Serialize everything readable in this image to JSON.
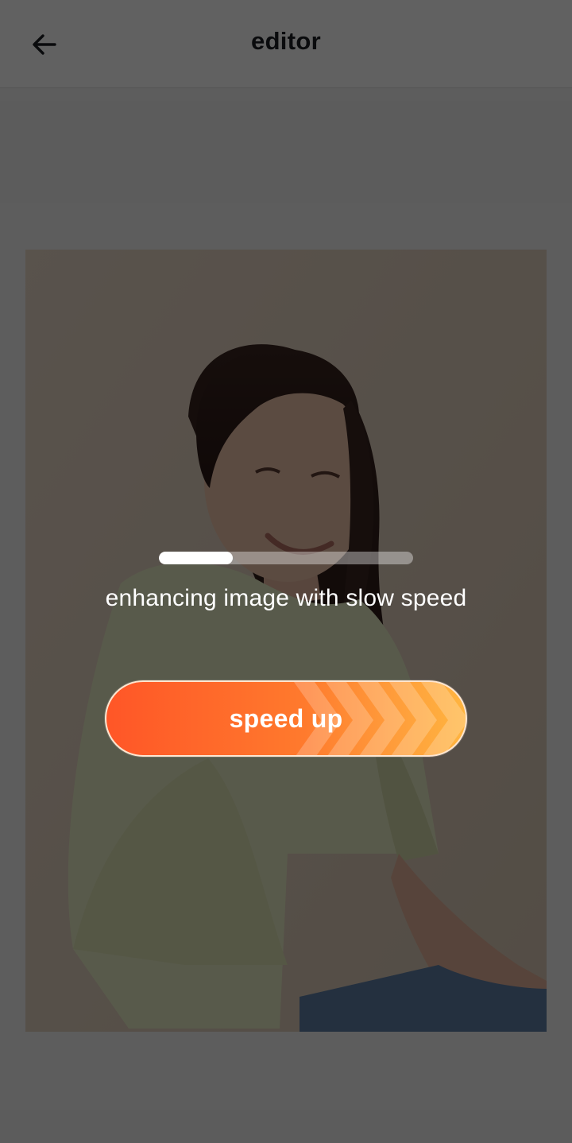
{
  "header": {
    "title": "editor",
    "back_icon": "arrow-left-icon"
  },
  "photo": {
    "subject": "woman in pale yellow blouse on beige background"
  },
  "progress": {
    "value": 0.29,
    "status_text": "enhancing image with slow speed"
  },
  "actions": {
    "speed_up_label": "speed up",
    "speed_up_icon": "chevrons-right-icon"
  },
  "colors": {
    "accent_start": "#ff5627",
    "accent_end": "#ffb540",
    "scrim": "rgba(0,0,0,0.62)"
  }
}
